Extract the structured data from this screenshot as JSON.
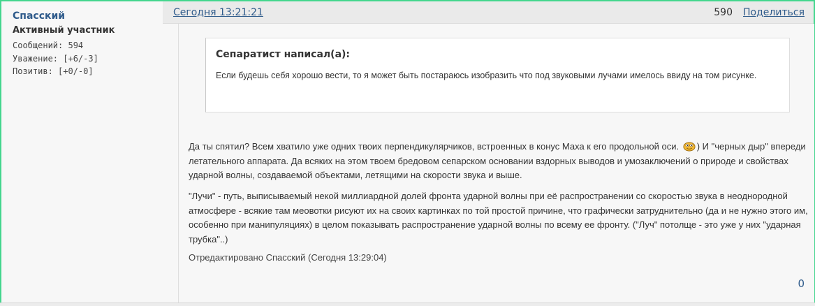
{
  "author": {
    "name": "Спасский",
    "rank": "Активный участник",
    "stats": [
      "Сообщений: 594",
      "Уважение: [+6/-3]",
      "Позитив: [+0/-0]"
    ]
  },
  "post": {
    "date": "Сегодня 13:21:21",
    "number": "590",
    "share_label": "Поделиться",
    "quote": {
      "title": "Сепаратист написал(а):",
      "text": "Если будешь себя хорошо вести, то я может быть постараюсь изобразить что под звуковыми лучами имелось ввиду на том рисунке."
    },
    "paragraph1_part1": "Да ты спятил? Всем хватило уже одних твоих перпендикулярчиков, встроенных в конус Маха к его продольной оси.",
    "paragraph1_part2": ") И \"черных дыр\" впереди летательного аппарата. Да всяких на этом твоем бредовом сепарском основании вздорных выводов и умозаключений о природе и свойствах ударной волны, создаваемой объектами, летящими на скорости звука и выше.",
    "paragraph2": "\"Лучи\" - путь, выписываемый некой миллиардной долей фронта ударной волны при её распространении со скоростью звука в неоднородной атмосфере - всякие там меовотки рисуют их на своих картинках по той простой причине, что графически затруднительно (да и не нужно этого им, особенно при манипуляциях) в целом показывать распространение ударной волны по всему ее фронту. (\"Луч\" потолще  - это уже у них \"ударная  трубка\"..)",
    "edited": "Отредактировано Спасский (Сегодня 13:29:04)",
    "counter": "0"
  },
  "icons": {
    "smiley": "smiley-icon"
  },
  "colors": {
    "link": "#2f5b8b",
    "frame_border": "#44d68e",
    "background": "#f7f7f7"
  }
}
